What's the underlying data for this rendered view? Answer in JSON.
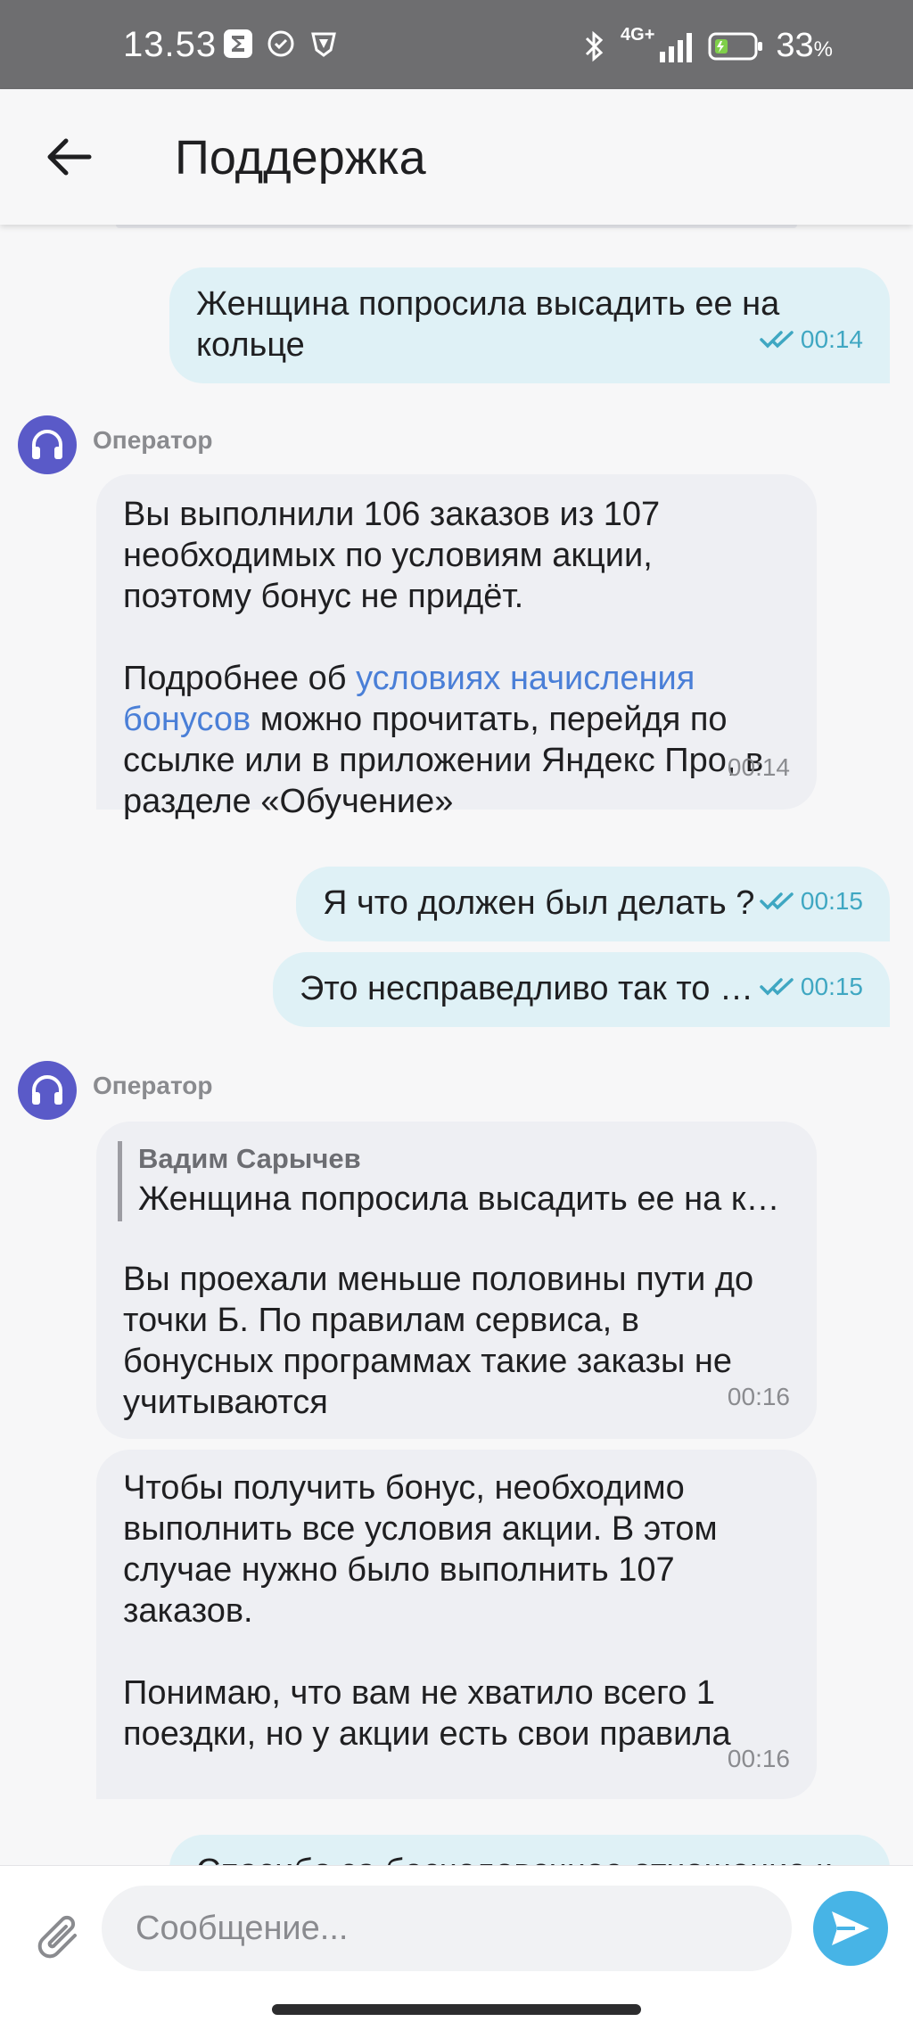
{
  "status_bar": {
    "time": "13.53",
    "network": "4G+",
    "battery_percent": "33",
    "battery_unit": "%"
  },
  "header": {
    "title": "Поддержка"
  },
  "messages": {
    "m1": {
      "text": "Женщина попросила высадить ее на\nкольце",
      "time": "00:14"
    },
    "op1": {
      "sender": "Оператор"
    },
    "m2": {
      "text_a": "Вы выполнили 106 заказов из 107\nнеобходимых по условиям акции,\nпоэтому бонус не придёт.\n\nПодробнее об ",
      "link": "условиях начисления\nбонусов",
      "text_b": " можно прочитать, перейдя по\nссылке или в приложении Яндекс Про, в\nразделе «Обучение»",
      "time": "00:14"
    },
    "m3": {
      "text": "Я что должен был делать ?",
      "time": "00:15"
    },
    "m4": {
      "text": "Это несправедливо так то …",
      "time": "00:15"
    },
    "op2": {
      "sender": "Оператор"
    },
    "m5": {
      "quote_author": "Вадим Сарычев",
      "quote_text": "Женщина попросила высадить ее на к…",
      "text": "Вы проехали меньше половины пути до\nточки Б. По правилам сервиса, в\nбонусных программах такие заказы не\nучитываются",
      "time": "00:16"
    },
    "m6": {
      "text": "Чтобы получить бонус, необходимо\nвыполнить все условия акции. В этом\nслучае нужно было выполнить 107\nзаказов.\n\nПонимаю, что вам не хватило всего 1\nпоездки, но у акции есть свои правила",
      "time": "00:16"
    },
    "m7": {
      "text": "Спасибо за бесчеловечное отношение к"
    }
  },
  "composer": {
    "placeholder": "Сообщение..."
  },
  "colors": {
    "accent": "#47b4e6",
    "user_bubble": "#dff1f6",
    "operator_bubble": "#eeeff3",
    "link": "#4a7fd7",
    "avatar": "#5a5ac8"
  }
}
